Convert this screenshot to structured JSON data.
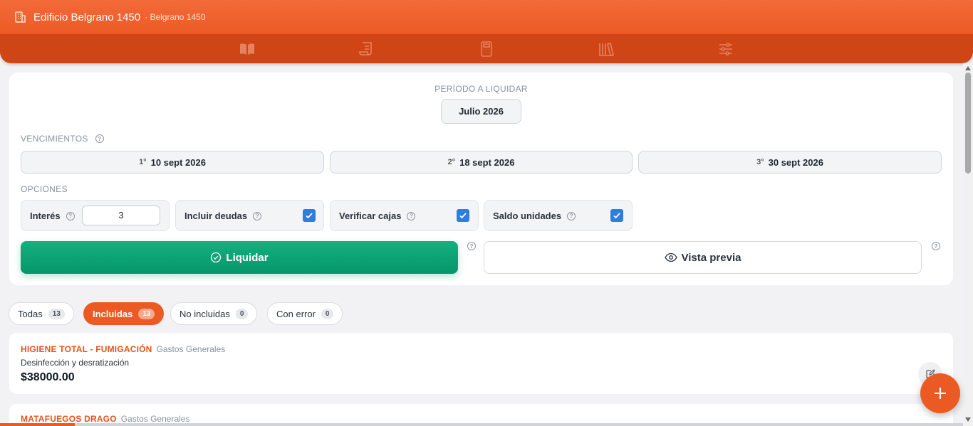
{
  "header": {
    "title": "Edificio Belgrano 1450",
    "subtitle": "· Belgrano 1450",
    "nav_icons": [
      "book-icon",
      "receipt-icon",
      "calculator-icon",
      "library-icon",
      "sliders-icon"
    ]
  },
  "periodo": {
    "label": "PERÍODO A LIQUIDAR",
    "value": "Julio 2026"
  },
  "vencimientos": {
    "label": "VENCIMIENTOS",
    "items": [
      {
        "ord": "1°",
        "date": "10 sept 2026"
      },
      {
        "ord": "2°",
        "date": "18 sept 2026"
      },
      {
        "ord": "3°",
        "date": "30 sept 2026"
      }
    ]
  },
  "opciones": {
    "label": "OPCIONES",
    "interes": {
      "label": "Interés",
      "value": "3"
    },
    "incluir_deudas": {
      "label": "Incluir deudas",
      "checked": true
    },
    "verificar_cajas": {
      "label": "Verificar cajas",
      "checked": true
    },
    "saldo_unidades": {
      "label": "Saldo unidades",
      "checked": true
    }
  },
  "actions": {
    "liquidar": "Liquidar",
    "vista_previa": "Vista previa"
  },
  "tabs": [
    {
      "label": "Todas",
      "count": "13",
      "active": false
    },
    {
      "label": "Incluidas",
      "count": "13",
      "active": true
    },
    {
      "label": "No incluidas",
      "count": "0",
      "active": false
    },
    {
      "label": "Con error",
      "count": "0",
      "active": false
    }
  ],
  "items": [
    {
      "provider": "HIGIENE TOTAL - FUMIGACIÓN",
      "category": "Gastos Generales",
      "description": "Desinfección y desratización",
      "amount": "$38000.00"
    },
    {
      "provider": "MATAFUEGOS DRAGO",
      "category": "Gastos Generales"
    }
  ],
  "colors": {
    "brand": "#ec5a24",
    "nav_dark": "#cf4516",
    "success": "#05966a",
    "checkbox": "#2f7de1"
  }
}
